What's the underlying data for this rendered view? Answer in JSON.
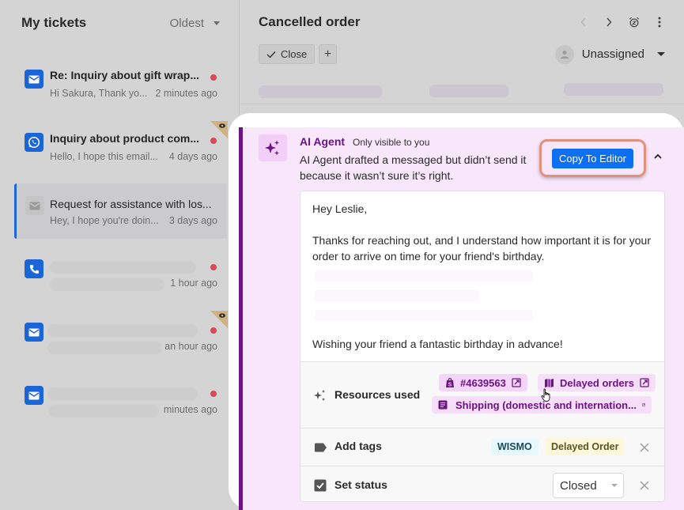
{
  "sidebar": {
    "title": "My tickets",
    "sort_label": "Oldest",
    "tickets": [
      {
        "channel": "email-icon",
        "title": "Re: Inquiry about gift wrap...",
        "preview": "Hi Sakura, Thank yo...",
        "time": "2 minutes ago",
        "unread": true,
        "watched": false,
        "selected": false
      },
      {
        "channel": "whatsapp-icon",
        "title": "Inquiry about product com...",
        "preview": "Hello, I hope this email...",
        "time": "4 days ago",
        "unread": true,
        "watched": true,
        "selected": false
      },
      {
        "channel": "email-icon",
        "title": "Request for assistance with los...",
        "preview": "Hey, I hope you're doin...",
        "time": "3 days ago",
        "unread": false,
        "watched": false,
        "selected": true
      },
      {
        "channel": "phone-icon",
        "title": "",
        "preview": "",
        "time": "1 hour ago",
        "unread": true,
        "watched": false,
        "selected": false
      },
      {
        "channel": "email-icon",
        "title": "",
        "preview": "",
        "time": "an hour ago",
        "unread": true,
        "watched": true,
        "selected": false
      },
      {
        "channel": "email-icon",
        "title": "",
        "preview": "",
        "time": "minutes ago",
        "unread": true,
        "watched": false,
        "selected": false
      }
    ]
  },
  "main": {
    "title": "Cancelled order",
    "close_label": "Close",
    "add_label": "+",
    "assignee": "Unassigned"
  },
  "ai": {
    "name": "AI Agent",
    "visibility": "Only visible to you",
    "description": "AI Agent drafted a messaged but didn’t send it because it wasn’t sure it’s right.",
    "copy_label": "Copy To Editor",
    "draft": {
      "greeting": "Hey Leslie,",
      "para1": "Thanks for reaching out, and I understand how important it is for your order to arrive on time for your friend's birthday.",
      "closing": "Wishing your friend a fantastic birthday in advance!"
    },
    "resources": {
      "label": "Resources used",
      "items": [
        {
          "icon": "shopify-icon",
          "label": "#4639563"
        },
        {
          "icon": "book-icon",
          "label": "Delayed orders"
        },
        {
          "icon": "document-icon",
          "label": "Shipping (domestic and internation..."
        }
      ]
    },
    "tags": {
      "label": "Add tags",
      "items": [
        {
          "label": "WISMO",
          "bg": "#e6f8fb",
          "fg": "#1b4a5c"
        },
        {
          "label": "Delayed Order",
          "bg": "#fbf8dc",
          "fg": "#5c5520"
        }
      ]
    },
    "status": {
      "label": "Set status",
      "value": "Closed"
    }
  },
  "colors": {
    "accent_purple": "#6b1486",
    "primary_blue": "#0d6ff1",
    "channel_blue": "#1a66d6",
    "unread_red": "#d6485a"
  }
}
